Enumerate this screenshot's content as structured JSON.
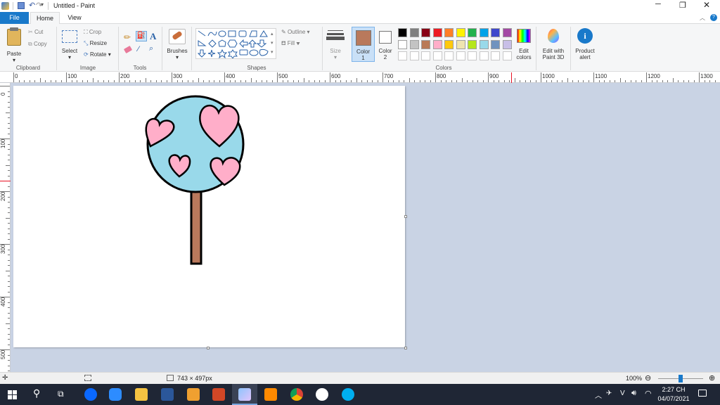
{
  "window": {
    "title": "Untitled - Paint"
  },
  "tabs": {
    "file": "File",
    "home": "Home",
    "view": "View"
  },
  "clipboard": {
    "paste": "Paste",
    "cut": "Cut",
    "copy": "Copy",
    "label": "Clipboard"
  },
  "image": {
    "select": "Select",
    "crop": "Crop",
    "resize": "Resize",
    "rotate": "Rotate",
    "label": "Image"
  },
  "tools": {
    "label": "Tools"
  },
  "brushes": {
    "label": "Brushes"
  },
  "shapes": {
    "label": "Shapes",
    "outline": "Outline",
    "fill": "Fill"
  },
  "size": {
    "label": "Size"
  },
  "color1": {
    "label": "Color",
    "num": "1",
    "value": "#b9795c"
  },
  "color2": {
    "label": "Color",
    "num": "2",
    "value": "#ffffff"
  },
  "colors": {
    "label": "Colors",
    "edit": "Edit",
    "edit2": "colors",
    "palette": [
      "#000000",
      "#7f7f7f",
      "#880015",
      "#ed1c24",
      "#ff7f27",
      "#fff200",
      "#22b14c",
      "#00a2e8",
      "#3f48cc",
      "#a349a4",
      "#ffffff",
      "#c3c3c3",
      "#b97a57",
      "#ffaec9",
      "#ffc90e",
      "#efe4b0",
      "#b5e61d",
      "#99d9ea",
      "#7092be",
      "#c8bfe7"
    ]
  },
  "paint3d": {
    "l1": "Edit with",
    "l2": "Paint 3D"
  },
  "alert": {
    "l1": "Product",
    "l2": "alert"
  },
  "ruler": {
    "h": [
      "0",
      "100",
      "200",
      "300",
      "400",
      "500",
      "600",
      "700",
      "800",
      "900",
      "1000",
      "1100",
      "1200",
      "1300"
    ],
    "v": [
      "0",
      "100",
      "200",
      "300",
      "400",
      "500"
    ]
  },
  "status": {
    "dimensions": "743 × 497px",
    "zoom": "100%"
  },
  "clock": {
    "time": "2:27 CH",
    "date": "04/07/2021"
  },
  "tray": {
    "lang": "V"
  }
}
